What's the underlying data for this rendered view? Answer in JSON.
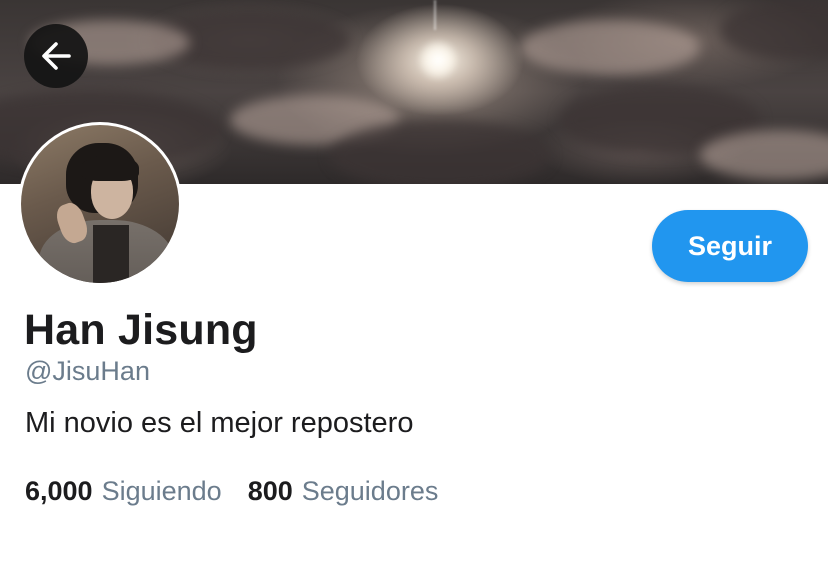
{
  "profile": {
    "name": "Han Jisung",
    "handle": "@JisuHan",
    "bio": "Mi novio es el mejor repostero"
  },
  "actions": {
    "follow_label": "Seguir"
  },
  "stats": {
    "following_count": "6,000",
    "following_label": "Siguiendo",
    "followers_count": "800",
    "followers_label": "Seguidores"
  },
  "icons": {
    "back": "arrow-left-icon"
  },
  "colors": {
    "accent": "#2196ef",
    "text_primary": "#1c1c1e",
    "text_secondary": "#6b7c8c",
    "back_button_bg": "#141414"
  }
}
